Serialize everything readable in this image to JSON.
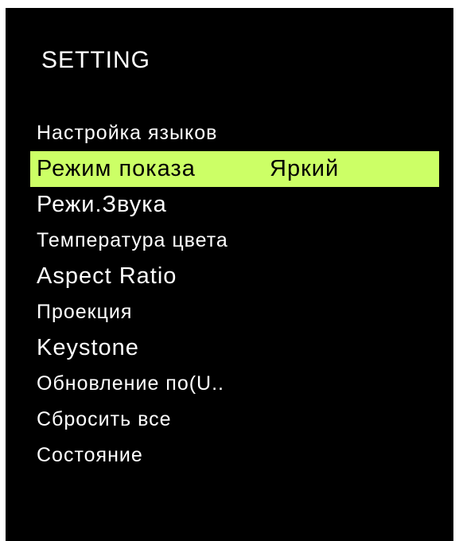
{
  "osd": {
    "title": "SETTING",
    "items": [
      {
        "label": "Настройка языков"
      },
      {
        "label": "Режим показа",
        "value": "Яркий"
      },
      {
        "label": "Режи.Звука"
      },
      {
        "label": "Температура цвета"
      },
      {
        "label": "Aspect Ratio"
      },
      {
        "label": "Проекция"
      },
      {
        "label": "Keystone"
      },
      {
        "label": "Обновление по(U.."
      },
      {
        "label": "Сбросить все"
      },
      {
        "label": "Состояние"
      }
    ]
  },
  "colors": {
    "panel_background": "#000000",
    "text": "#ffffff",
    "selection_highlight": "#ccff66",
    "selection_text": "#000000"
  }
}
